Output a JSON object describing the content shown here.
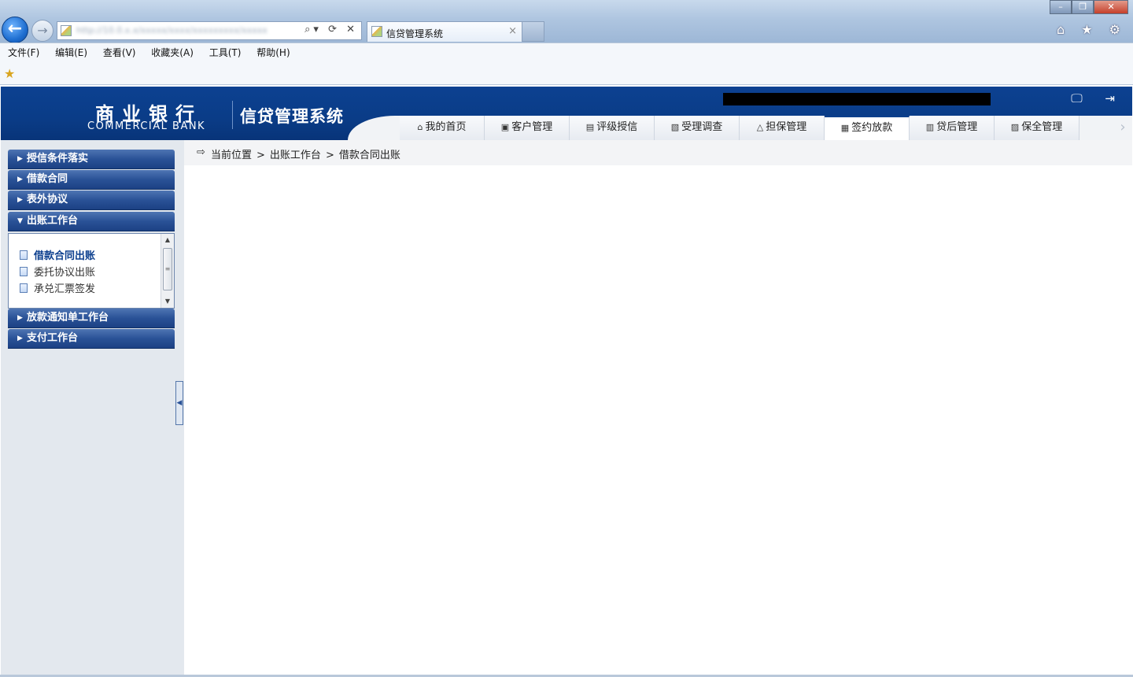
{
  "browser": {
    "tab_title": "信贷管理系统",
    "tab_close": "×",
    "address_url": "http://10.0.x.x/xxxxx/xxxx/xxxxxxxxx/xxxxx",
    "back_glyph": "←",
    "forward_glyph": "→",
    "address_tools": "⌕▾ ⟳ ✕",
    "window_controls": [
      "–",
      "❐",
      "✕"
    ],
    "right_icons": "⌂ ★ ⚙",
    "menu": [
      "文件(F)",
      "编辑(E)",
      "查看(V)",
      "收藏夹(A)",
      "工具(T)",
      "帮助(H)"
    ]
  },
  "header": {
    "logo_cn": "商业银行",
    "logo_en": "COMMERCIAL BANK",
    "system_name": "信贷管理系统",
    "icons": "🖵 ⇥"
  },
  "nav_tabs": [
    {
      "label": "我的首页",
      "icon": "⌂"
    },
    {
      "label": "客户管理",
      "icon": "▣"
    },
    {
      "label": "评级授信",
      "icon": "▤"
    },
    {
      "label": "受理调查",
      "icon": "▧"
    },
    {
      "label": "担保管理",
      "icon": "△"
    },
    {
      "label": "签约放款",
      "icon": "▦"
    },
    {
      "label": "贷后管理",
      "icon": "▥"
    },
    {
      "label": "保全管理",
      "icon": "▨"
    }
  ],
  "active_nav_tab": "签约放款",
  "sidebar": {
    "sections": [
      {
        "label": "授信条件落实",
        "expanded": false
      },
      {
        "label": "借款合同",
        "expanded": false
      },
      {
        "label": "表外协议",
        "expanded": false
      },
      {
        "label": "出账工作台",
        "expanded": true
      },
      {
        "label": "放款通知单工作台",
        "expanded": false
      },
      {
        "label": "支付工作台",
        "expanded": false
      }
    ],
    "expanded_items": [
      "借款合同出账",
      "委托协议出账",
      "承兑汇票签发"
    ],
    "active_item": "借款合同出账"
  },
  "breadcrumb": {
    "prefix": "当前位置",
    "separator": ">",
    "path": [
      "出账工作台",
      "借款合同出账"
    ]
  },
  "colors": {
    "header_blue": "#0a3c87",
    "sidebar_header": "#2a5297",
    "sidebar_bg": "#e3e8ee",
    "active_item": "#0c3f8e"
  }
}
